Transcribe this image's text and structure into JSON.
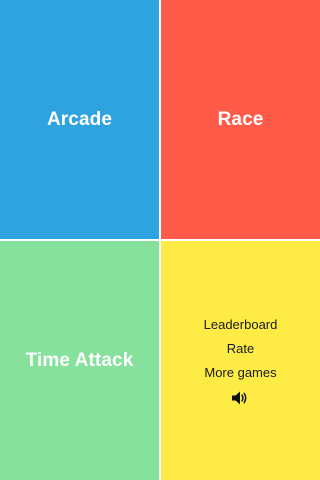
{
  "colors": {
    "arcade": "#2fa2e0",
    "race": "#ff5b48",
    "time_attack": "#86e19c",
    "menu": "#ffeb45"
  },
  "modes": {
    "arcade": "Arcade",
    "race": "Race",
    "time_attack": "Time Attack"
  },
  "menu": {
    "leaderboard": "Leaderboard",
    "rate": "Rate",
    "more_games": "More games",
    "sound_icon": "speaker-icon"
  }
}
